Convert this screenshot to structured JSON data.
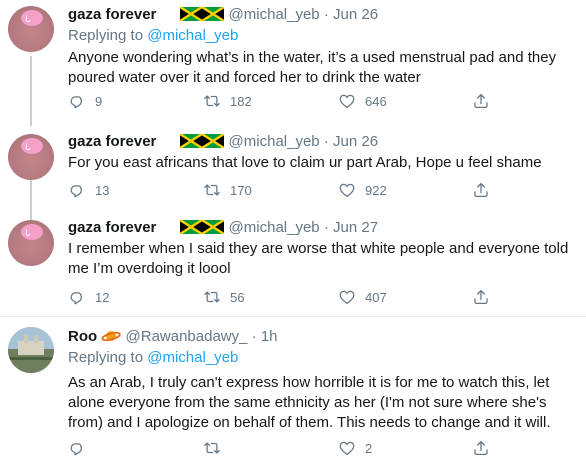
{
  "tweets": [
    {
      "name": "gaza forever",
      "handle": "@michal_yeb",
      "sep": "·",
      "date": "Jun 26",
      "replying_prefix": "Replying to ",
      "replying_to": "@michal_yeb",
      "text": "Anyone wondering what’s in the water, it’s a used menstrual pad and they poured water over it and forced her to drink the water",
      "replies": "9",
      "retweets": "182",
      "likes": "646"
    },
    {
      "name": "gaza forever",
      "handle": "@michal_yeb",
      "sep": "·",
      "date": "Jun 26",
      "text": "For you east africans that love to claim ur part Arab, Hope u feel shame",
      "replies": "13",
      "retweets": "170",
      "likes": "922"
    },
    {
      "name": "gaza forever",
      "handle": "@michal_yeb",
      "sep": "·",
      "date": "Jun 27",
      "text": "I remember when I said they are worse that white people and everyone told me I’m overdoing it loool",
      "replies": "12",
      "retweets": "56",
      "likes": "407"
    },
    {
      "name": "Roo",
      "handle": "@Rawanbadawy_",
      "sep": "·",
      "date": "1h",
      "replying_prefix": "Replying to ",
      "replying_to": "@michal_yeb",
      "text": "As an Arab, I truly can't express how horrible it is for me to watch this, let alone everyone from the same ethnicity as her (I'm not sure where she's from) and I apologize on behalf of them. This needs to change and it will.",
      "replies": "",
      "retweets": "",
      "likes": "2"
    }
  ],
  "icons": {
    "reply": "reply-icon",
    "retweet": "retweet-icon",
    "like": "heart-icon",
    "share": "share-icon",
    "flag": "jamaica-flag-icon",
    "emoji": "orange-ring-planet-icon"
  },
  "colors": {
    "text": "#14171a",
    "muted": "#657786",
    "link": "#1da1f2",
    "divider": "#e6ecf0",
    "thread_line": "#c4cfd6"
  }
}
